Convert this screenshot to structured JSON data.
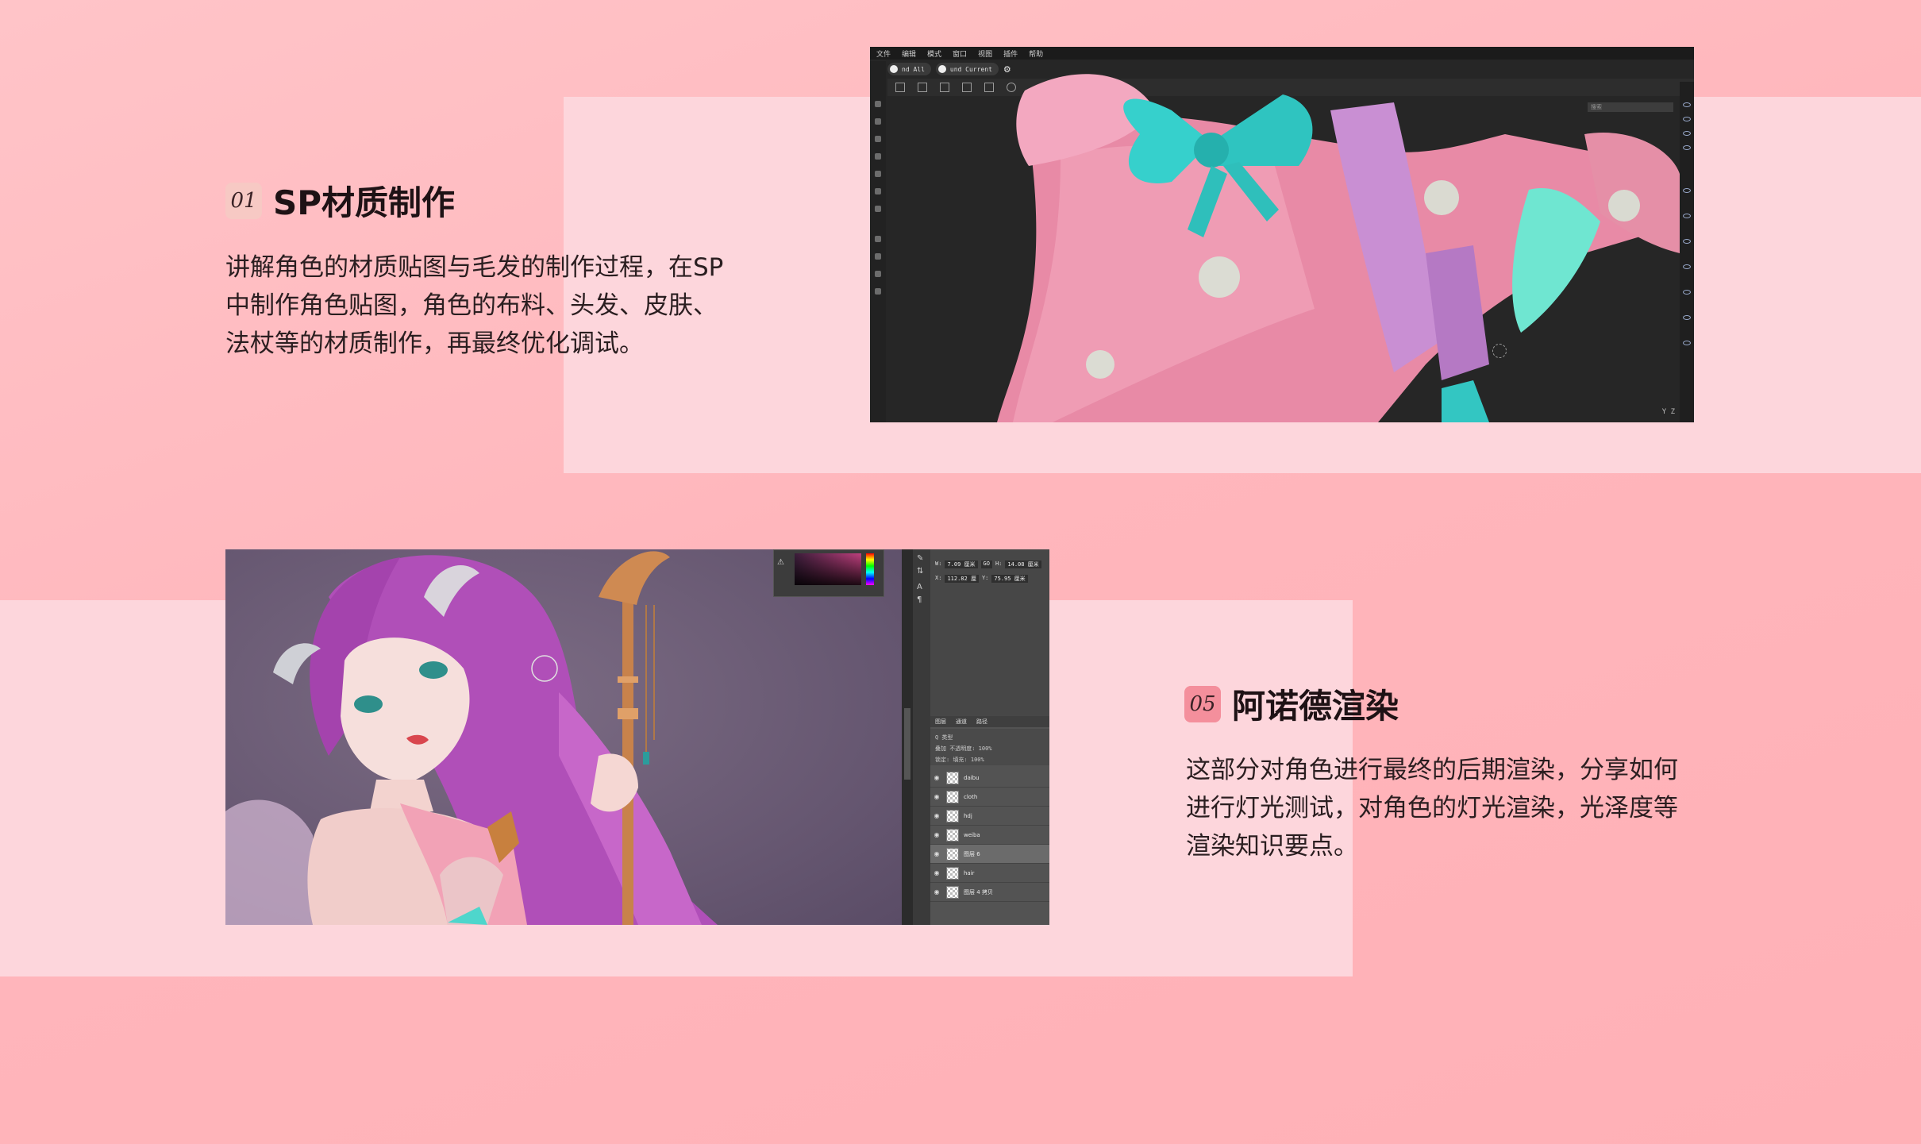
{
  "section1": {
    "badge": "01",
    "title": "SP材质制作",
    "description": "讲解角色的材质贴图与毛发的制作过程，在SP中制作角色贴图，角色的布料、头发、皮肤、法杖等的材质制作，再最终优化调试。"
  },
  "section2": {
    "badge": "05",
    "title": "阿诺德渲染",
    "description": "这部分对角色进行最终的后期渲染，分享如何进行灯光测试，对角色的灯光渲染，光泽度等渲染知识要点。"
  },
  "substance_painter": {
    "menu": [
      "文件",
      "编辑",
      "模式",
      "窗口",
      "视图",
      "插件",
      "帮助"
    ],
    "tabs": [
      "nd All",
      "und Current"
    ],
    "search_placeholder": "搜索",
    "axis": "Y  Z"
  },
  "photoshop": {
    "props": {
      "w_label": "W:",
      "w_value": "7.09 厘米",
      "link": "GO",
      "h_label": "H:",
      "h_value": "14.08 厘米",
      "x_label": "X:",
      "x_value": "112.82 厘",
      "y_label": "Y:",
      "y_value": "75.95 厘米"
    },
    "layer_tabs": [
      "图层",
      "通道",
      "路径"
    ],
    "filter_label": "Q 类型",
    "blend_mode": "叠加",
    "opacity_label": "不透明度:",
    "opacity_value": "100%",
    "lock_label": "锁定:",
    "fill_label": "填充:",
    "fill_value": "100%",
    "layers": [
      {
        "name": "daibu",
        "selected": false
      },
      {
        "name": "cloth",
        "selected": false
      },
      {
        "name": "hdj",
        "selected": false
      },
      {
        "name": "weiba",
        "selected": false
      },
      {
        "name": "图层 6",
        "selected": true
      },
      {
        "name": "hair",
        "selected": false
      },
      {
        "name": "图层 4 拷贝",
        "selected": false
      }
    ]
  },
  "colors": {
    "background": "#ffb6bc",
    "panel": "#fdd6dc",
    "title_text": "#1e1215",
    "badge_light": "#f7c9c4",
    "badge_pink": "#f48f9c"
  }
}
